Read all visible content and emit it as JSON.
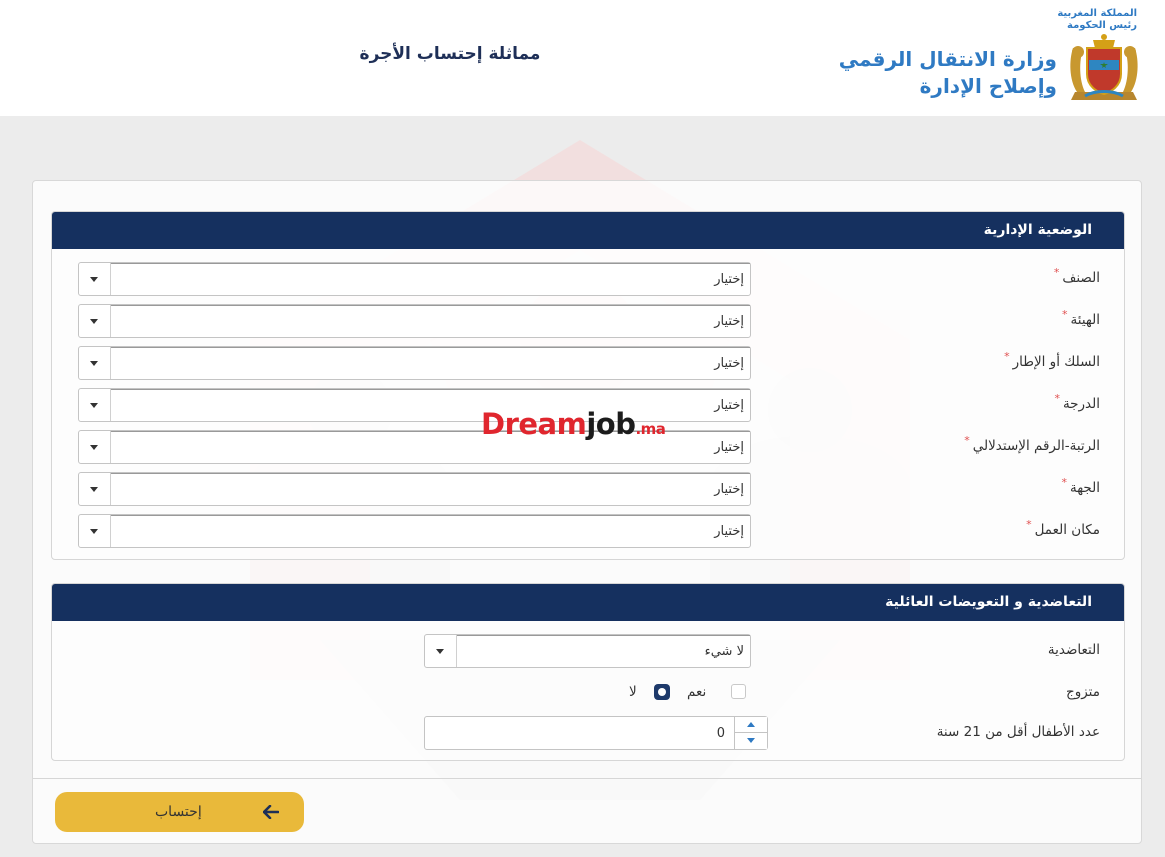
{
  "header": {
    "page_title": "مماثلة إحتساب الأجرة",
    "ministry_line1": "وزارة الانتقال الرقمي",
    "ministry_line2": "وإصلاح الإدارة",
    "kingdom_line1": "المملكة المغربية",
    "kingdom_line2": "رئيس الحكومة"
  },
  "watermark": {
    "brand_part1": "Dream",
    "brand_part2": "job",
    "brand_part3": ".ma"
  },
  "admin_panel": {
    "title": "الوضعية الإدارية",
    "required_mark": "*",
    "fields": [
      {
        "label": "الصنف",
        "value": "إختيار"
      },
      {
        "label": "الهيئة",
        "value": "إختيار"
      },
      {
        "label": "السلك أو الإطار",
        "value": "إختيار"
      },
      {
        "label": "الدرجة",
        "value": "إختيار"
      },
      {
        "label": "الرتبة-الرقم الإستدلالي",
        "value": "إختيار"
      },
      {
        "label": "الجهة",
        "value": "إختيار"
      },
      {
        "label": "مكان العمل",
        "value": "إختيار"
      }
    ]
  },
  "family_panel": {
    "title": "التعاضدية و التعويضات العائلية",
    "mutual_label": "التعاضدية",
    "mutual_value": "لا شيء",
    "married_label": "متزوج",
    "option_yes": "نعم",
    "option_no": "لا",
    "married_selected": "لا",
    "children_label": "عدد الأطفال أقل من 21 سنة",
    "children_value": "0"
  },
  "actions": {
    "calculate_label": "إحتساب"
  },
  "colors": {
    "panel_header": "#15305f",
    "accent_blue": "#2f7ac3",
    "button_gold": "#e9b93a",
    "brand_red": "#e0262e"
  }
}
